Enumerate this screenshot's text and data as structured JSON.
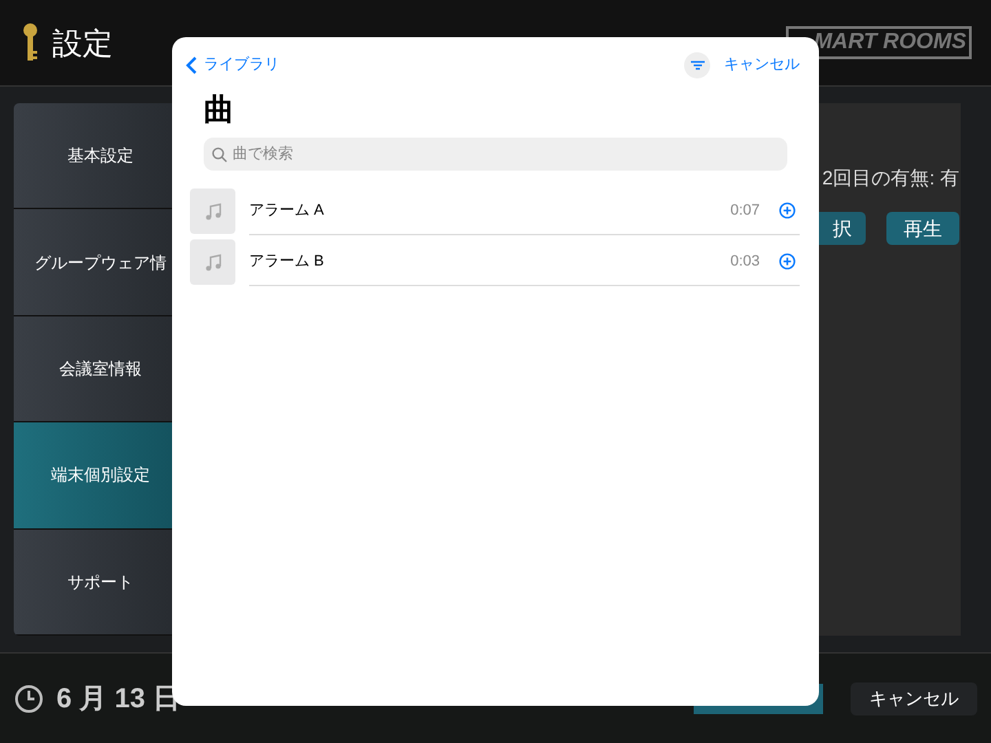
{
  "header": {
    "title": "設定",
    "logo": "MART ROOMS"
  },
  "sidebar": {
    "items": [
      {
        "label": "基本設定",
        "selected": false
      },
      {
        "label": "グループウェア情",
        "selected": false
      },
      {
        "label": "会議室情報",
        "selected": false
      },
      {
        "label": "端末個別設定",
        "selected": true
      },
      {
        "label": "サポート",
        "selected": false
      }
    ]
  },
  "content": {
    "repeat_text": "2回目の有無: 有",
    "buttons": [
      "択",
      "再生"
    ]
  },
  "footer": {
    "date": "6 月 13 日",
    "cancel": "キャンセル"
  },
  "modal": {
    "back": "ライブラリ",
    "cancel": "キャンセル",
    "title": "曲",
    "search": {
      "placeholder": "曲で検索"
    },
    "songs": [
      {
        "title": "アラーム A",
        "duration": "0:07"
      },
      {
        "title": "アラーム B",
        "duration": "0:03"
      }
    ]
  }
}
